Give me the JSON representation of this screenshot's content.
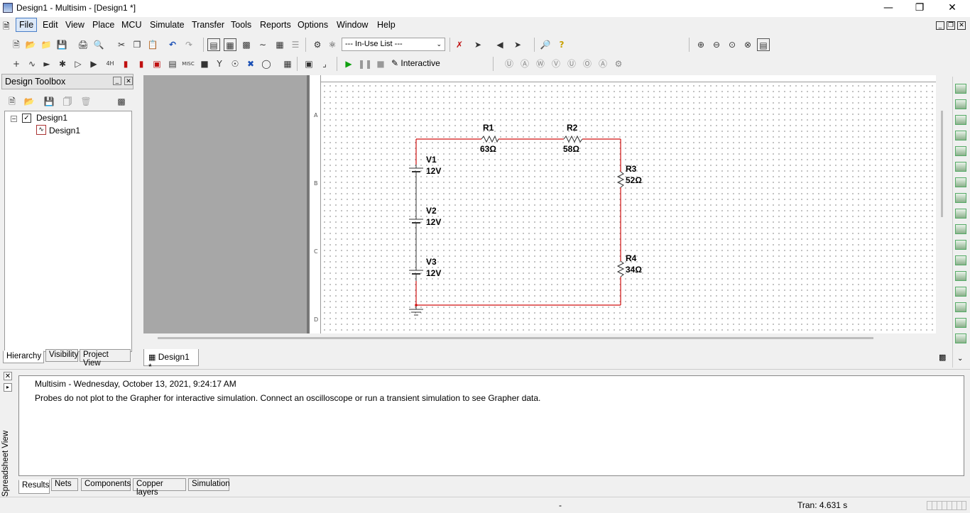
{
  "window": {
    "title": "Design1 - Multisim - [Design1 *]"
  },
  "menu": [
    "File",
    "Edit",
    "View",
    "Place",
    "MCU",
    "Simulate",
    "Transfer",
    "Tools",
    "Reports",
    "Options",
    "Window",
    "Help"
  ],
  "toolbar": {
    "in_use_list": "--- In-Use List ---",
    "interactive_label": "Interactive"
  },
  "toolbox": {
    "title": "Design Toolbox",
    "tree": {
      "root": "Design1",
      "child": "Design1"
    },
    "tabs": [
      "Hierarchy",
      "Visibility",
      "Project View"
    ]
  },
  "ruler": {
    "zones": [
      "A",
      "B",
      "C",
      "D"
    ]
  },
  "schematic": {
    "components": [
      {
        "ref": "R1",
        "value": "63Ω"
      },
      {
        "ref": "R2",
        "value": "58Ω"
      },
      {
        "ref": "R3",
        "value": "52Ω"
      },
      {
        "ref": "R4",
        "value": "34Ω"
      },
      {
        "ref": "V1",
        "value": "12V"
      },
      {
        "ref": "V2",
        "value": "12V"
      },
      {
        "ref": "V3",
        "value": "12V"
      }
    ],
    "wire_color": "#d01010"
  },
  "design_tab": "Design1 *",
  "spreadsheet": {
    "label": "Spreadsheet View",
    "log_header": "Multisim  -  Wednesday, October 13, 2021, 9:24:17 AM",
    "log_message": "Probes do not plot to the Grapher for interactive simulation. Connect an oscilloscope or run a transient simulation to see Grapher data.",
    "tabs": [
      "Results",
      "Nets",
      "Components",
      "Copper layers",
      "Simulation"
    ]
  },
  "status": {
    "center": "-",
    "tran": "Tran: 4.631 s"
  }
}
